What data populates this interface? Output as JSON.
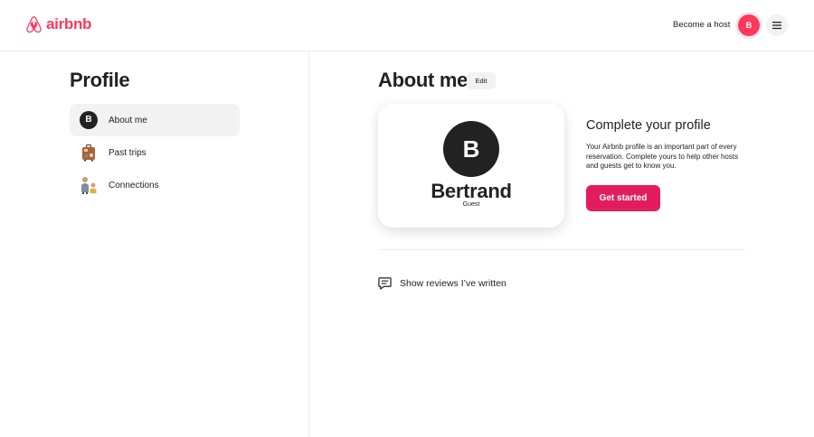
{
  "header": {
    "logo_text": "airbnb",
    "become_host": "Become a host",
    "avatar_initial": "B"
  },
  "sidebar": {
    "title": "Profile",
    "items": [
      {
        "label": "About me",
        "icon": "avatar-b-icon",
        "initial": "B",
        "active": true
      },
      {
        "label": "Past trips",
        "icon": "suitcase-icon"
      },
      {
        "label": "Connections",
        "icon": "people-icon"
      }
    ]
  },
  "main": {
    "title": "About me",
    "edit_label": "Edit",
    "card": {
      "initial": "B",
      "name": "Bertrand",
      "role": "Guest"
    },
    "cta": {
      "title": "Complete your profile",
      "text": "Your Airbnb profile is an important part of every reservation. Complete yours to help other hosts and guests get to know you.",
      "button": "Get started"
    },
    "reviews_link": "Show reviews I’ve written"
  },
  "colors": {
    "brand": "#ff385c",
    "button": "#e31c5f",
    "text": "#222222"
  }
}
